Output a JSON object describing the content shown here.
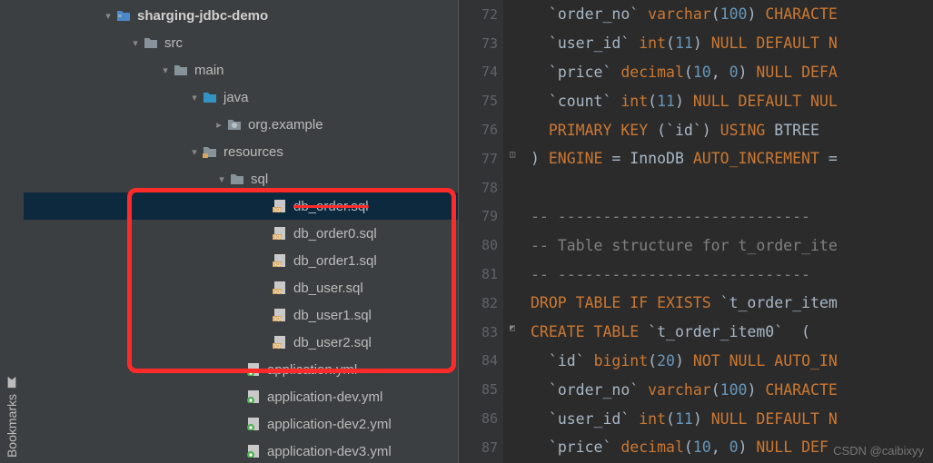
{
  "sidebar_tab": "Bookmarks",
  "tree": [
    {
      "indent": 85,
      "arrow": "down",
      "icon": "module",
      "label": "sharging-jdbc-demo",
      "bold": true
    },
    {
      "indent": 115,
      "arrow": "down",
      "icon": "folder",
      "label": "src"
    },
    {
      "indent": 148,
      "arrow": "down",
      "icon": "folder",
      "label": "main"
    },
    {
      "indent": 180,
      "arrow": "down",
      "icon": "folder-blue",
      "label": "java"
    },
    {
      "indent": 207,
      "arrow": "right",
      "icon": "package",
      "label": "org.example"
    },
    {
      "indent": 180,
      "arrow": "down",
      "icon": "resources",
      "label": "resources"
    },
    {
      "indent": 210,
      "arrow": "down",
      "icon": "folder",
      "label": "sql"
    },
    {
      "indent": 257,
      "arrow": "",
      "icon": "sql",
      "label": "db_order.sql",
      "selected": true,
      "struck": true
    },
    {
      "indent": 257,
      "arrow": "",
      "icon": "sql",
      "label": "db_order0.sql"
    },
    {
      "indent": 257,
      "arrow": "",
      "icon": "sql",
      "label": "db_order1.sql"
    },
    {
      "indent": 257,
      "arrow": "",
      "icon": "sql",
      "label": "db_user.sql"
    },
    {
      "indent": 257,
      "arrow": "",
      "icon": "sql",
      "label": "db_user1.sql"
    },
    {
      "indent": 257,
      "arrow": "",
      "icon": "sql",
      "label": "db_user2.sql"
    },
    {
      "indent": 228,
      "arrow": "",
      "icon": "yml",
      "label": "application.yml",
      "struck": true
    },
    {
      "indent": 228,
      "arrow": "",
      "icon": "yml",
      "label": "application-dev.yml"
    },
    {
      "indent": 228,
      "arrow": "",
      "icon": "yml",
      "label": "application-dev2.yml"
    },
    {
      "indent": 228,
      "arrow": "",
      "icon": "yml",
      "label": "application-dev3.yml"
    }
  ],
  "gutter_start": 72,
  "code": [
    {
      "tokens": [
        {
          "t": "  `",
          "c": "ident"
        },
        {
          "t": "order_no",
          "c": "ident"
        },
        {
          "t": "` ",
          "c": "ident"
        },
        {
          "t": "varchar",
          "c": "keyword"
        },
        {
          "t": "(",
          "c": "paren"
        },
        {
          "t": "100",
          "c": "num"
        },
        {
          "t": ") ",
          "c": "paren"
        },
        {
          "t": "CHARACTE",
          "c": "keyword"
        }
      ]
    },
    {
      "tokens": [
        {
          "t": "  `",
          "c": "ident"
        },
        {
          "t": "user_id",
          "c": "ident"
        },
        {
          "t": "` ",
          "c": "ident"
        },
        {
          "t": "int",
          "c": "keyword"
        },
        {
          "t": "(",
          "c": "paren"
        },
        {
          "t": "11",
          "c": "num"
        },
        {
          "t": ") ",
          "c": "paren"
        },
        {
          "t": "NULL DEFAULT ",
          "c": "keyword"
        },
        {
          "t": "N",
          "c": "keyword"
        }
      ]
    },
    {
      "tokens": [
        {
          "t": "  `",
          "c": "ident"
        },
        {
          "t": "price",
          "c": "ident"
        },
        {
          "t": "` ",
          "c": "ident"
        },
        {
          "t": "decimal",
          "c": "keyword"
        },
        {
          "t": "(",
          "c": "paren"
        },
        {
          "t": "10",
          "c": "num"
        },
        {
          "t": ", ",
          "c": "paren"
        },
        {
          "t": "0",
          "c": "num"
        },
        {
          "t": ") ",
          "c": "paren"
        },
        {
          "t": "NULL DEFA",
          "c": "keyword"
        }
      ]
    },
    {
      "tokens": [
        {
          "t": "  `",
          "c": "ident"
        },
        {
          "t": "count",
          "c": "ident"
        },
        {
          "t": "` ",
          "c": "ident"
        },
        {
          "t": "int",
          "c": "keyword"
        },
        {
          "t": "(",
          "c": "paren"
        },
        {
          "t": "11",
          "c": "num"
        },
        {
          "t": ") ",
          "c": "paren"
        },
        {
          "t": "NULL DEFAULT NUL",
          "c": "keyword"
        }
      ]
    },
    {
      "tokens": [
        {
          "t": "  ",
          "c": "ident"
        },
        {
          "t": "PRIMARY KEY ",
          "c": "keyword"
        },
        {
          "t": "(`",
          "c": "ident"
        },
        {
          "t": "id",
          "c": "ident"
        },
        {
          "t": "`) ",
          "c": "ident"
        },
        {
          "t": "USING ",
          "c": "keyword"
        },
        {
          "t": "BTREE",
          "c": "ident"
        }
      ]
    },
    {
      "fold": "up",
      "tokens": [
        {
          "t": ") ",
          "c": "paren"
        },
        {
          "t": "ENGINE",
          "c": "keyword"
        },
        {
          "t": " = ",
          "c": "ident"
        },
        {
          "t": "InnoDB ",
          "c": "ident"
        },
        {
          "t": "AUTO_INCREMENT",
          "c": "keyword"
        },
        {
          "t": " =",
          "c": "ident"
        }
      ]
    },
    {
      "tokens": []
    },
    {
      "tokens": [
        {
          "t": "-- ----------------------------",
          "c": "comment"
        }
      ]
    },
    {
      "tokens": [
        {
          "t": "-- Table structure for t_order_ite",
          "c": "comment"
        }
      ]
    },
    {
      "tokens": [
        {
          "t": "-- ----------------------------",
          "c": "comment"
        }
      ]
    },
    {
      "tokens": [
        {
          "t": "DROP TABLE IF EXISTS ",
          "c": "keyword"
        },
        {
          "t": "`t_order_item",
          "c": "ident"
        }
      ]
    },
    {
      "fold": "down",
      "tokens": [
        {
          "t": "CREATE TABLE ",
          "c": "keyword"
        },
        {
          "t": "`t_order_item0`  (",
          "c": "ident"
        }
      ]
    },
    {
      "tokens": [
        {
          "t": "  `",
          "c": "ident"
        },
        {
          "t": "id",
          "c": "ident"
        },
        {
          "t": "` ",
          "c": "ident"
        },
        {
          "t": "bigint",
          "c": "keyword"
        },
        {
          "t": "(",
          "c": "paren"
        },
        {
          "t": "20",
          "c": "num"
        },
        {
          "t": ") ",
          "c": "paren"
        },
        {
          "t": "NOT NULL AUTO_IN",
          "c": "keyword"
        }
      ]
    },
    {
      "tokens": [
        {
          "t": "  `",
          "c": "ident"
        },
        {
          "t": "order_no",
          "c": "ident"
        },
        {
          "t": "` ",
          "c": "ident"
        },
        {
          "t": "varchar",
          "c": "keyword"
        },
        {
          "t": "(",
          "c": "paren"
        },
        {
          "t": "100",
          "c": "num"
        },
        {
          "t": ") ",
          "c": "paren"
        },
        {
          "t": "CHARACTE",
          "c": "keyword"
        }
      ]
    },
    {
      "tokens": [
        {
          "t": "  `",
          "c": "ident"
        },
        {
          "t": "user_id",
          "c": "ident"
        },
        {
          "t": "` ",
          "c": "ident"
        },
        {
          "t": "int",
          "c": "keyword"
        },
        {
          "t": "(",
          "c": "paren"
        },
        {
          "t": "11",
          "c": "num"
        },
        {
          "t": ") ",
          "c": "paren"
        },
        {
          "t": "NULL DEFAULT ",
          "c": "keyword"
        },
        {
          "t": "N",
          "c": "keyword"
        }
      ]
    },
    {
      "tokens": [
        {
          "t": "  `",
          "c": "ident"
        },
        {
          "t": "price",
          "c": "ident"
        },
        {
          "t": "` ",
          "c": "ident"
        },
        {
          "t": "decimal",
          "c": "keyword"
        },
        {
          "t": "(",
          "c": "paren"
        },
        {
          "t": "10",
          "c": "num"
        },
        {
          "t": ", ",
          "c": "paren"
        },
        {
          "t": "0",
          "c": "num"
        },
        {
          "t": ") ",
          "c": "paren"
        },
        {
          "t": "NULL DEF",
          "c": "keyword"
        }
      ]
    }
  ],
  "watermark": "CSDN @caibixyy"
}
